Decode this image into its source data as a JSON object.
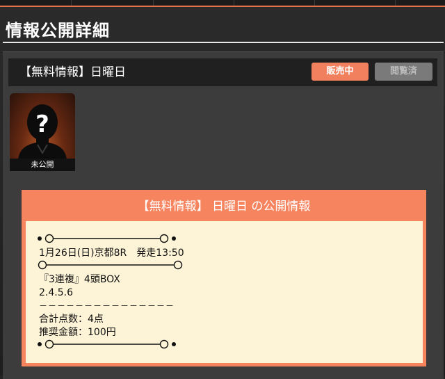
{
  "page": {
    "title": "情報公開詳細"
  },
  "header": {
    "title": "【無料情報】日曜日",
    "sale_button": "販売中",
    "viewed_button": "閲覧済"
  },
  "avatar": {
    "label": "未公開",
    "icon": "unknown-person-icon"
  },
  "info": {
    "title": "【無料情報】 日曜日 の公開情報",
    "lines": [
      "1月26日(日)京都8R　発走13:50",
      "『3連複』4頭BOX",
      "2.4.5.6",
      "－－－－－－－－－－－－－－－",
      "合計点数：4点",
      "推奨金額：100円"
    ]
  },
  "colors": {
    "accent": "#f6845e",
    "sale_button": "#f0805e",
    "viewed_button": "#7a7a7a",
    "info_background": "#fdf3d6"
  }
}
